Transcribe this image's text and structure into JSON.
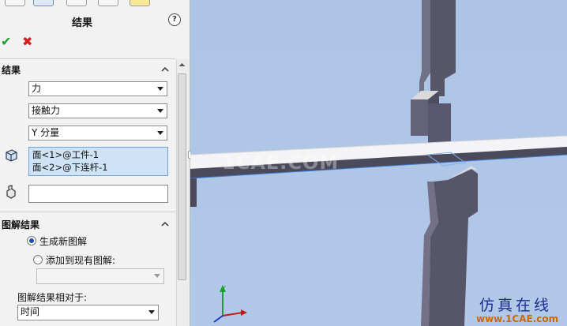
{
  "panel": {
    "title": "结果",
    "help_icon_glyph": "?",
    "ok_icon": "checkmark-icon",
    "cancel_icon": "x-icon",
    "results_section": {
      "title": "结果",
      "select_type": "力",
      "select_force": "接触力",
      "select_component": "Y 分量",
      "faces": [
        "面<1>@工件-1",
        "面<2>@下连杆-1"
      ],
      "part_input_value": ""
    },
    "plot_section": {
      "title": "图解结果",
      "radio_new": "生成新图解",
      "radio_existing": "添加到现有图解:",
      "existing_plot_value": "",
      "relative_label": "图解结果相对于:",
      "relative_value": "时间"
    }
  },
  "viewport": {
    "watermark": "1CAE.COM",
    "logo_text": "仿真在线",
    "logo_url": "www.1CAE.com",
    "triad_label": "Y"
  },
  "colors": {
    "viewport_bg": "#aec4e6",
    "part_dark": "#56566a",
    "part_light": "#f2f2f2",
    "accept": "#1e9e2a",
    "cancel": "#d02020"
  }
}
